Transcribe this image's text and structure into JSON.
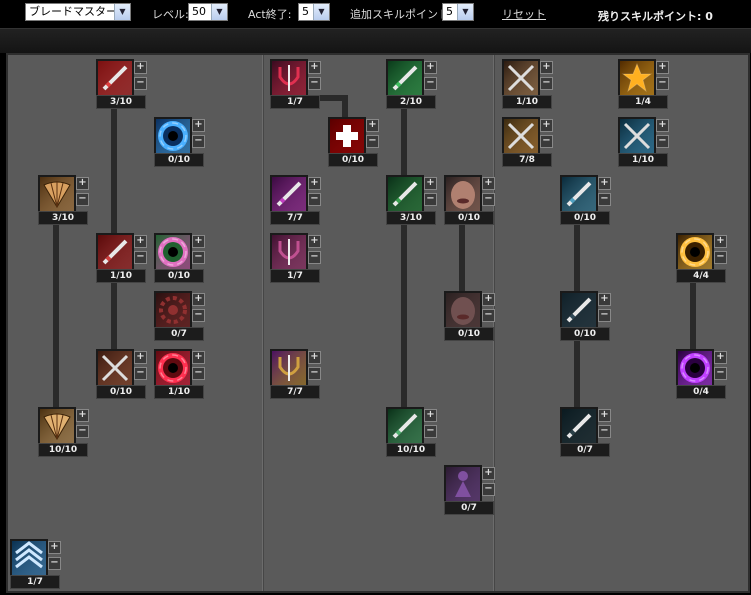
{
  "toolbar": {
    "class_select": "ブレードマスター",
    "level_label": "レベル:",
    "level_value": "50",
    "act_label": "Act終了:",
    "act_value": "5",
    "bonus_label": "追加スキルポイント:",
    "bonus_value": "5",
    "reset_label": "リセット",
    "remaining_label": "残りスキルポイント: 0"
  },
  "skills": [
    {
      "id": "s1",
      "icon": "red-blade-icon",
      "level": "3/10",
      "colors": [
        "#7a1010",
        "#e04040"
      ]
    },
    {
      "id": "s2",
      "icon": "blue-vortex-icon",
      "level": "0/10",
      "colors": [
        "#0a3060",
        "#4ab0ff"
      ]
    },
    {
      "id": "s3",
      "icon": "bronze-fan-icon",
      "level": "3/10",
      "colors": [
        "#4a2e10",
        "#d8a060"
      ]
    },
    {
      "id": "s4",
      "icon": "red-sword-icon",
      "level": "1/10",
      "colors": [
        "#5a0a0a",
        "#d04040"
      ]
    },
    {
      "id": "s5",
      "icon": "rainbow-vortex-icon",
      "level": "0/10",
      "colors": [
        "#206030",
        "#e070c0"
      ]
    },
    {
      "id": "s6",
      "icon": "red-gear-icon",
      "level": "0/7",
      "colors": [
        "#2a1010",
        "#903030"
      ]
    },
    {
      "id": "s7",
      "icon": "crossed-daggers-icon",
      "level": "0/10",
      "colors": [
        "#3a1a10",
        "#b06040"
      ]
    },
    {
      "id": "s8",
      "icon": "red-vortex-icon",
      "level": "1/10",
      "colors": [
        "#600a10",
        "#ff3050"
      ]
    },
    {
      "id": "s9",
      "icon": "golden-fan-icon",
      "level": "10/10",
      "colors": [
        "#4a3010",
        "#e0b070"
      ]
    },
    {
      "id": "s10",
      "icon": "blue-chevron-icon",
      "level": "1/7",
      "colors": [
        "#0a3050",
        "#50a0e0"
      ]
    },
    {
      "id": "s11",
      "icon": "red-trident-icon",
      "level": "1/7",
      "colors": [
        "#3a0a20",
        "#e03050"
      ]
    },
    {
      "id": "s12",
      "icon": "red-cross-icon",
      "level": "0/10",
      "colors": [
        "#5a0000",
        "#cc0000"
      ]
    },
    {
      "id": "s13",
      "icon": "purple-blade-icon",
      "level": "7/7",
      "colors": [
        "#3a0a40",
        "#c040c0"
      ]
    },
    {
      "id": "s14",
      "icon": "purple-trident-icon",
      "level": "1/7",
      "colors": [
        "#401030",
        "#c05090"
      ]
    },
    {
      "id": "s15",
      "icon": "purple-gold-shield-icon",
      "level": "7/7",
      "colors": [
        "#4a1060",
        "#d0a040"
      ]
    },
    {
      "id": "s16",
      "icon": "green-slash-icon",
      "level": "2/10",
      "colors": [
        "#0a3a1a",
        "#40c060"
      ]
    },
    {
      "id": "s17",
      "icon": "green-sword-icon",
      "level": "3/10",
      "colors": [
        "#0a3018",
        "#3aa050"
      ]
    },
    {
      "id": "s18",
      "icon": "face-icon",
      "level": "0/10",
      "colors": [
        "#2a2020",
        "#b08070"
      ]
    },
    {
      "id": "s19",
      "icon": "lips-icon",
      "level": "0/10",
      "colors": [
        "#2a2020",
        "#705050"
      ]
    },
    {
      "id": "s20",
      "icon": "green-bow-icon",
      "level": "10/10",
      "colors": [
        "#0a3018",
        "#50b070"
      ]
    },
    {
      "id": "s21",
      "icon": "purple-figure-icon",
      "level": "0/7",
      "colors": [
        "#2a1a30",
        "#8050a0"
      ]
    },
    {
      "id": "s22",
      "icon": "swirl-blades-icon",
      "level": "1/10",
      "colors": [
        "#2a1a10",
        "#c09060"
      ]
    },
    {
      "id": "s23",
      "icon": "crossed-swords-icon",
      "level": "7/8",
      "colors": [
        "#3a2a10",
        "#d09040"
      ]
    },
    {
      "id": "s24",
      "icon": "gold-star-icon",
      "level": "1/4",
      "colors": [
        "#502a00",
        "#ffb020"
      ]
    },
    {
      "id": "s25",
      "icon": "blue-crossed-icon",
      "level": "1/10",
      "colors": [
        "#0a2a3a",
        "#40a0d0"
      ]
    },
    {
      "id": "s26",
      "icon": "blue-blade-icon",
      "level": "0/10",
      "colors": [
        "#0a2a3a",
        "#50a0c0"
      ]
    },
    {
      "id": "s27",
      "icon": "dark-blade-icon",
      "level": "0/10",
      "colors": [
        "#102028",
        "#304a58"
      ]
    },
    {
      "id": "s28",
      "icon": "dark-sword-icon",
      "level": "0/7",
      "colors": [
        "#0a1a20",
        "#2a4048"
      ]
    },
    {
      "id": "s29",
      "icon": "gold-vortex-icon",
      "level": "4/4",
      "colors": [
        "#3a2000",
        "#ffc040"
      ]
    },
    {
      "id": "s30",
      "icon": "purple-vortex-icon",
      "level": "0/4",
      "colors": [
        "#2a0040",
        "#c040ff"
      ]
    }
  ]
}
